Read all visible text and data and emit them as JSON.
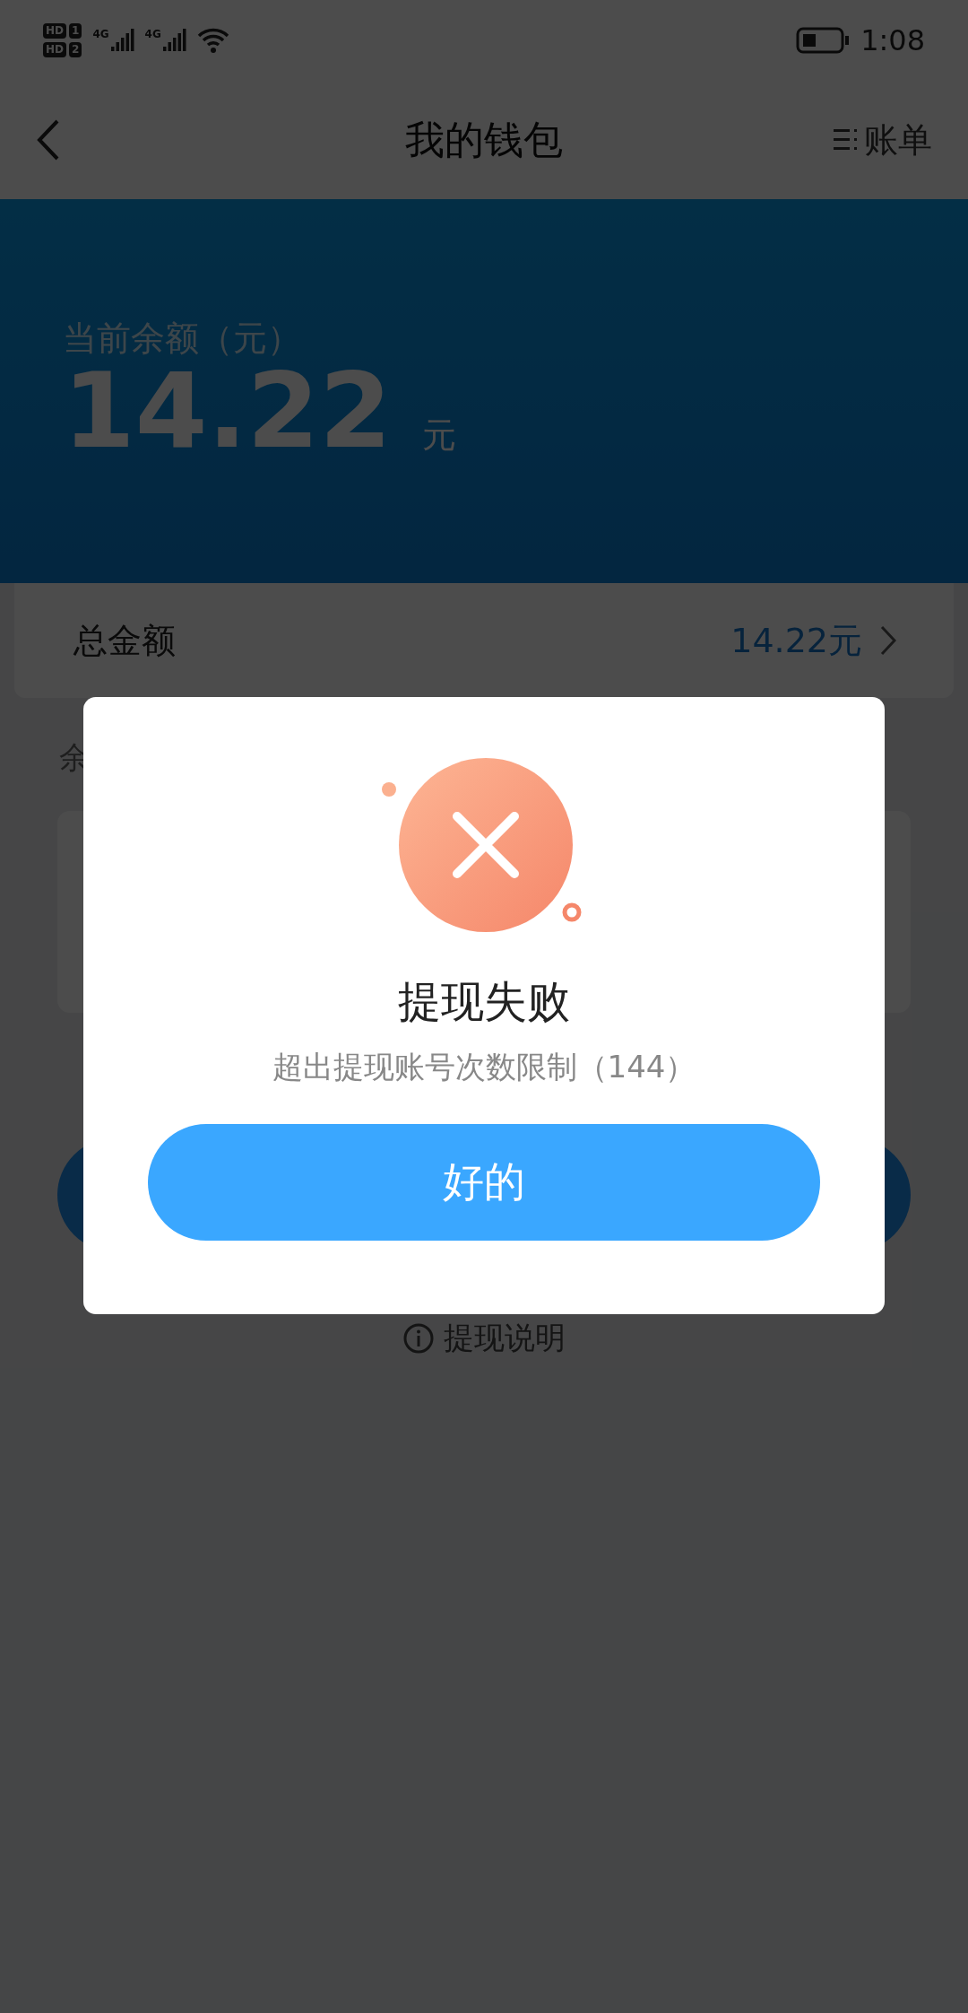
{
  "status_bar": {
    "sims": [
      {
        "badge": "HD",
        "slot": "1"
      },
      {
        "badge": "HD",
        "slot": "2"
      }
    ],
    "networks": [
      "4G",
      "4G"
    ],
    "time": "1:08"
  },
  "nav": {
    "title": "我的钱包",
    "action": "账单"
  },
  "balance": {
    "label": "当前余额（元）",
    "amount": "14.22",
    "unit": "元"
  },
  "total_row": {
    "label": "总金额",
    "value": "14.22元"
  },
  "section_label": "余",
  "help_link": "提现说明",
  "dialog": {
    "title": "提现失败",
    "message": "超出提现账号次数限制（144）",
    "button": "好的"
  }
}
